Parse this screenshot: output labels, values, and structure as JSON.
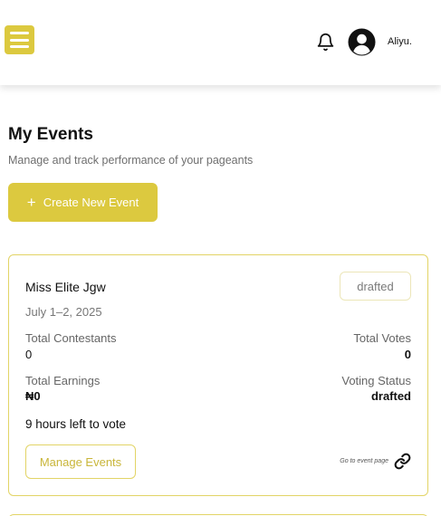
{
  "header": {
    "menu_icon": "hamburger-menu-icon",
    "notification_icon": "bell-icon",
    "avatar_icon": "user-avatar-icon",
    "username": "Aliyu."
  },
  "page": {
    "title": "My Events",
    "subtitle": "Manage and track performance of your pageants",
    "create_button_label": "Create New Event",
    "create_button_icon": "plus-icon"
  },
  "colors": {
    "accent": "#dcc93f",
    "card_border": "#e2d466"
  },
  "events": [
    {
      "name": "Miss Elite Jgw",
      "date": "July 1–2, 2025",
      "status_badge": "drafted",
      "total_contestants_label": "Total Contestants",
      "total_contestants": "0",
      "total_votes_label": "Total Votes",
      "total_votes": "0",
      "total_earnings_label": "Total Earnings",
      "total_earnings": "₦0",
      "voting_status_label": "Voting Status",
      "voting_status": "drafted",
      "time_left": "9 hours left to vote",
      "manage_button_label": "Manage Events",
      "goto_link_label": "Go to event page",
      "goto_link_icon": "link-icon"
    }
  ]
}
